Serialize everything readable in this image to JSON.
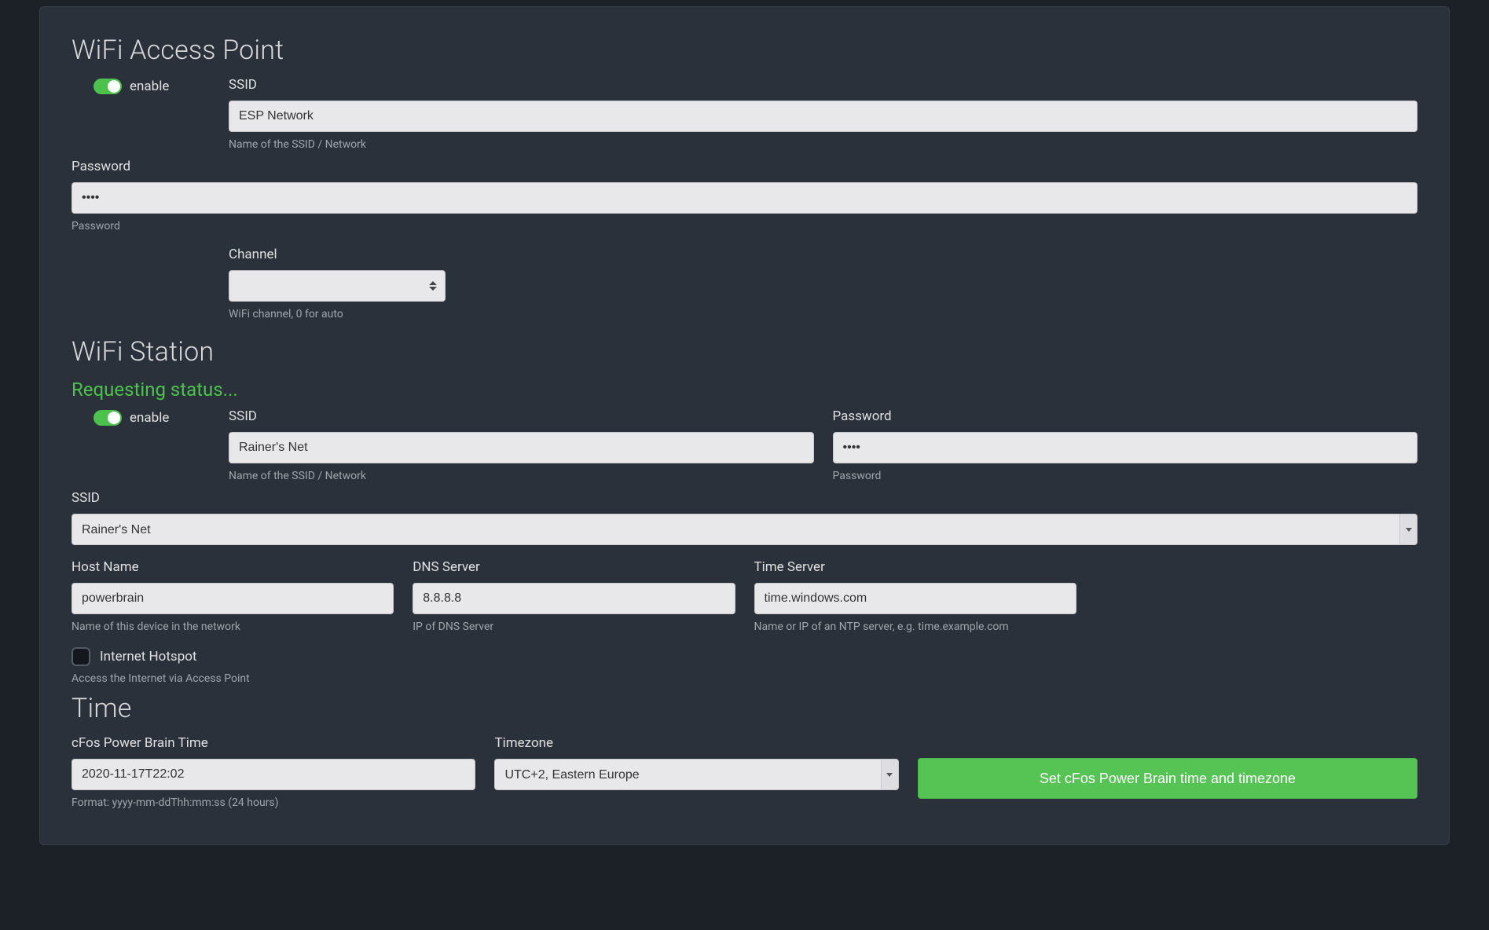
{
  "ap": {
    "title": "WiFi Access Point",
    "enable_label": "enable",
    "ssid_label": "SSID",
    "ssid_value": "ESP Network",
    "ssid_hint": "Name of the SSID / Network",
    "password_label": "Password",
    "password_value": "••••",
    "password_hint": "Password",
    "channel_label": "Channel",
    "channel_value": "",
    "channel_hint": "WiFi channel, 0 for auto"
  },
  "station": {
    "title": "WiFi Station",
    "status": "Requesting status...",
    "enable_label": "enable",
    "ssid_label": "SSID",
    "ssid_value": "Rainer's Net",
    "ssid_hint": "Name of the SSID / Network",
    "password_label": "Password",
    "password_value": "••••",
    "password_hint": "Password",
    "ssid_select_label": "SSID",
    "ssid_select_value": "Rainer's Net",
    "host_label": "Host Name",
    "host_value": "powerbrain",
    "host_hint": "Name of this device in the network",
    "dns_label": "DNS Server",
    "dns_value": "8.8.8.8",
    "dns_hint": "IP of DNS Server",
    "timesrv_label": "Time Server",
    "timesrv_value": "time.windows.com",
    "timesrv_hint": "Name or IP of an NTP server, e.g. time.example.com",
    "hotspot_label": "Internet Hotspot",
    "hotspot_hint": "Access the Internet via Access Point"
  },
  "time": {
    "title": "Time",
    "time_label": "cFos Power Brain Time",
    "time_value": "2020-11-17T22:02",
    "time_hint": "Format: yyyy-mm-ddThh:mm:ss (24 hours)",
    "tz_label": "Timezone",
    "tz_value": "UTC+2, Eastern Europe",
    "button_label": "Set cFos Power Brain time and timezone"
  }
}
